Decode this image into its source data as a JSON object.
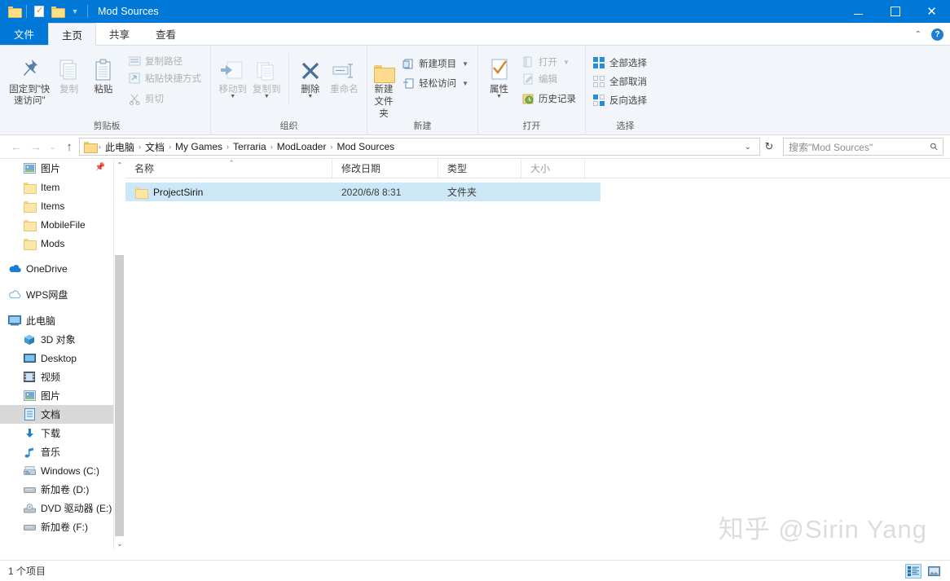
{
  "titlebar": {
    "title": "Mod Sources",
    "qat": [
      {
        "name": "folder-icon",
        "label": "属性"
      },
      {
        "name": "properties-icon",
        "label": "属性"
      },
      {
        "name": "new-folder-icon",
        "label": "新建文件夹"
      },
      {
        "name": "chevron-down-icon",
        "label": "自定义快速访问工具栏"
      }
    ],
    "minimize": "—",
    "maximize": "▢",
    "close": "✕"
  },
  "tabs": [
    {
      "label": "文件",
      "type": "file"
    },
    {
      "label": "主页",
      "type": "active"
    },
    {
      "label": "共享",
      "type": "normal"
    },
    {
      "label": "查看",
      "type": "normal"
    }
  ],
  "tabstrip_right": {
    "collapse_icon": "⌃",
    "help_icon": "?"
  },
  "ribbon": {
    "groups": [
      {
        "label": "剪贴板",
        "big": [
          {
            "label": "固定到\"快速访问\"",
            "icon": "pin-icon",
            "dim": false
          },
          {
            "label": "复制",
            "icon": "copy-icon",
            "dim": true
          },
          {
            "label": "粘贴",
            "icon": "paste-icon",
            "dim": false
          }
        ],
        "small": [
          {
            "label": "复制路径",
            "icon": "copy-path-icon",
            "dim": true
          },
          {
            "label": "粘贴快捷方式",
            "icon": "paste-shortcut-icon",
            "dim": true
          },
          {
            "label": "剪切",
            "icon": "cut-icon",
            "dim": true
          }
        ]
      },
      {
        "label": "组织",
        "big": [
          {
            "label": "移动到",
            "icon": "move-to-icon",
            "dim": true,
            "caret": true
          },
          {
            "label": "复制到",
            "icon": "copy-to-icon",
            "dim": true,
            "caret": true
          },
          {
            "label": "删除",
            "icon": "delete-icon",
            "dim": false,
            "caret": true
          },
          {
            "label": "重命名",
            "icon": "rename-icon",
            "dim": true
          }
        ],
        "small": []
      },
      {
        "label": "新建",
        "big": [
          {
            "label": "新建文件夹",
            "icon": "new-folder-icon",
            "dim": false
          }
        ],
        "small": [
          {
            "label": "新建项目",
            "icon": "new-item-icon",
            "dim": false,
            "caret": true
          },
          {
            "label": "轻松访问",
            "icon": "easy-access-icon",
            "dim": false,
            "caret": true
          }
        ]
      },
      {
        "label": "打开",
        "big": [
          {
            "label": "属性",
            "icon": "properties-icon",
            "dim": false,
            "caret": true
          }
        ],
        "small": [
          {
            "label": "打开",
            "icon": "open-icon",
            "dim": true,
            "caret": true
          },
          {
            "label": "编辑",
            "icon": "edit-icon",
            "dim": true
          },
          {
            "label": "历史记录",
            "icon": "history-icon",
            "dim": false
          }
        ]
      },
      {
        "label": "选择",
        "big": [],
        "small": [
          {
            "label": "全部选择",
            "icon": "select-all-icon",
            "dim": false
          },
          {
            "label": "全部取消",
            "icon": "select-none-icon",
            "dim": false
          },
          {
            "label": "反向选择",
            "icon": "invert-selection-icon",
            "dim": false
          }
        ]
      }
    ]
  },
  "addressbar": {
    "back_icon": "←",
    "forward_icon": "→",
    "recent_icon": "⌄",
    "up_icon": "↑",
    "crumbs": [
      "此电脑",
      "文档",
      "My Games",
      "Terraria",
      "ModLoader",
      "Mod Sources"
    ],
    "separator": "›",
    "dropdown_icon": "⌄",
    "refresh_icon": "↻",
    "search_placeholder": "搜索\"Mod Sources\"",
    "search_value": "",
    "search_icon": "search-icon"
  },
  "navpane": {
    "items": [
      {
        "label": "图片",
        "icon": "pictures-icon",
        "level": 1,
        "selected": false,
        "pinned": true
      },
      {
        "label": "Item",
        "icon": "folder-icon",
        "level": 1,
        "selected": false
      },
      {
        "label": "Items",
        "icon": "folder-icon",
        "level": 1,
        "selected": false
      },
      {
        "label": "MobileFile",
        "icon": "folder-icon",
        "level": 1,
        "selected": false
      },
      {
        "label": "Mods",
        "icon": "folder-icon",
        "level": 1,
        "selected": false
      },
      {
        "label": "OneDrive",
        "icon": "onedrive-icon",
        "level": 0,
        "selected": false,
        "spacer": true
      },
      {
        "label": "WPS网盘",
        "icon": "wps-cloud-icon",
        "level": 0,
        "selected": false,
        "spacer": true
      },
      {
        "label": "此电脑",
        "icon": "this-pc-icon",
        "level": 0,
        "selected": false,
        "spacer": true
      },
      {
        "label": "3D 对象",
        "icon": "3d-objects-icon",
        "level": 1,
        "selected": false
      },
      {
        "label": "Desktop",
        "icon": "desktop-icon",
        "level": 1,
        "selected": false
      },
      {
        "label": "视频",
        "icon": "videos-icon",
        "level": 1,
        "selected": false
      },
      {
        "label": "图片",
        "icon": "pictures-icon",
        "level": 1,
        "selected": false
      },
      {
        "label": "文档",
        "icon": "documents-icon",
        "level": 1,
        "selected": true
      },
      {
        "label": "下载",
        "icon": "downloads-icon",
        "level": 1,
        "selected": false
      },
      {
        "label": "音乐",
        "icon": "music-icon",
        "level": 1,
        "selected": false
      },
      {
        "label": "Windows (C:)",
        "icon": "drive-icon",
        "level": 1,
        "selected": false
      },
      {
        "label": "新加卷 (D:)",
        "icon": "drive-icon",
        "level": 1,
        "selected": false
      },
      {
        "label": "DVD 驱动器 (E:)",
        "icon": "dvd-drive-icon",
        "level": 1,
        "selected": false
      },
      {
        "label": "新加卷 (F:)",
        "icon": "drive-icon",
        "level": 1,
        "selected": false
      }
    ],
    "scroll_up_icon": "⌃",
    "scroll_down_icon": "⌄"
  },
  "filelist": {
    "columns": [
      {
        "label": "名称",
        "key": "name",
        "sorted": true,
        "sort_icon": "⌃"
      },
      {
        "label": "修改日期",
        "key": "date"
      },
      {
        "label": "类型",
        "key": "type"
      },
      {
        "label": "大小",
        "key": "size"
      }
    ],
    "rows": [
      {
        "name": "ProjectSirin",
        "date": "2020/6/8 8:31",
        "type": "文件夹",
        "size": "",
        "icon": "folder-icon",
        "selected": true
      }
    ]
  },
  "watermark": "知乎 @Sirin Yang",
  "statusbar": {
    "text": "1 个项目",
    "views": [
      {
        "name": "details-view-button",
        "active": true
      },
      {
        "name": "large-icons-view-button",
        "active": false
      }
    ]
  },
  "colors": {
    "accent": "#0078d7",
    "ribbon_bg": "#f2f6fa",
    "selection": "#cce8f7",
    "nav_selection": "#d8d8d8",
    "folder_yellow": "#fbdc8f"
  }
}
